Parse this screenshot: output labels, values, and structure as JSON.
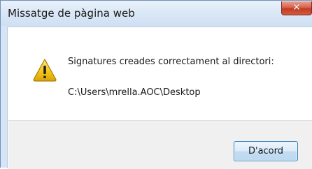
{
  "window": {
    "title": "Missatge de pàgina web",
    "close_glyph": "✕"
  },
  "dialog": {
    "icon": "warning-icon",
    "message": "Signatures creades correctament al directori:",
    "path": "C:\\Users\\mrella.AOC\\Desktop"
  },
  "buttons": {
    "ok_label": "D'acord"
  },
  "colors": {
    "titlebar": "#d6e5f5",
    "close_button": "#c8452c",
    "footer": "#f0f0f0",
    "button_border": "#3c7fb1",
    "warning_fill": "#f2c51c"
  }
}
